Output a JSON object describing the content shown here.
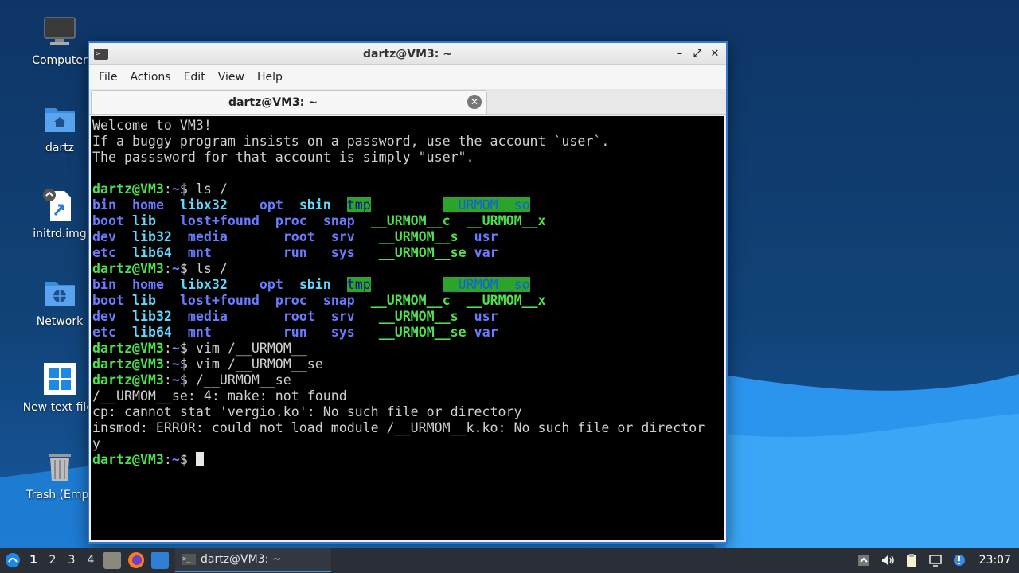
{
  "desktop": {
    "icons": [
      {
        "label": "Computer",
        "icon": "computer-icon"
      },
      {
        "label": "dartz",
        "icon": "home-folder-icon"
      },
      {
        "label": "initrd.img",
        "icon": "symlink-file-icon"
      },
      {
        "label": "Network",
        "icon": "network-folder-icon"
      },
      {
        "label": "New text file.",
        "icon": "text-file-icon"
      },
      {
        "label": "Trash (Empt",
        "icon": "trash-icon"
      }
    ]
  },
  "window": {
    "title": "dartz@VM3: ~",
    "controls": {
      "minimize": "–",
      "maximize": "⤢",
      "close": "✕"
    },
    "menu": [
      "File",
      "Actions",
      "Edit",
      "View",
      "Help"
    ],
    "tab_title": "dartz@VM3: ~"
  },
  "terminal": {
    "prompt_user": "dartz@VM3",
    "prompt_path": "~",
    "welcome": [
      "Welcome to VM3!",
      "If a buggy program insists on a password, use the account `user`.",
      "The passsword for that account is simply \"user\"."
    ],
    "cmd_ls": "ls /",
    "ls_rows": [
      [
        "bin",
        "home",
        "libx32",
        "opt",
        "sbin",
        "tmp",
        "__URMOM__so"
      ],
      [
        "boot",
        "lib",
        "lost+found",
        "proc",
        "snap",
        "__URMOM__c",
        "__URMOM__x"
      ],
      [
        "dev",
        "lib32",
        "media",
        "root",
        "srv",
        "__URMOM__s",
        "usr"
      ],
      [
        "etc",
        "lib64",
        "mnt",
        "run",
        "sys",
        "__URMOM__se",
        "var"
      ]
    ],
    "cmd_vim1": "vim /__URMOM__",
    "cmd_vim2": "vim /__URMOM__se",
    "cmd_run": "/__URMOM__se",
    "output": [
      "/__URMOM__se: 4: make: not found",
      "cp: cannot stat 'vergio.ko': No such file or directory",
      "insmod: ERROR: could not load module /__URMOM__k.ko: No such file or director",
      "y"
    ]
  },
  "taskbar": {
    "workspaces": [
      "1",
      "2",
      "3",
      "4"
    ],
    "active_workspace": "1",
    "task_label": "dartz@VM3: ~",
    "clock": "23:07",
    "colors": {
      "accent": "#4a90d9",
      "bar": "#2a2f37"
    }
  }
}
